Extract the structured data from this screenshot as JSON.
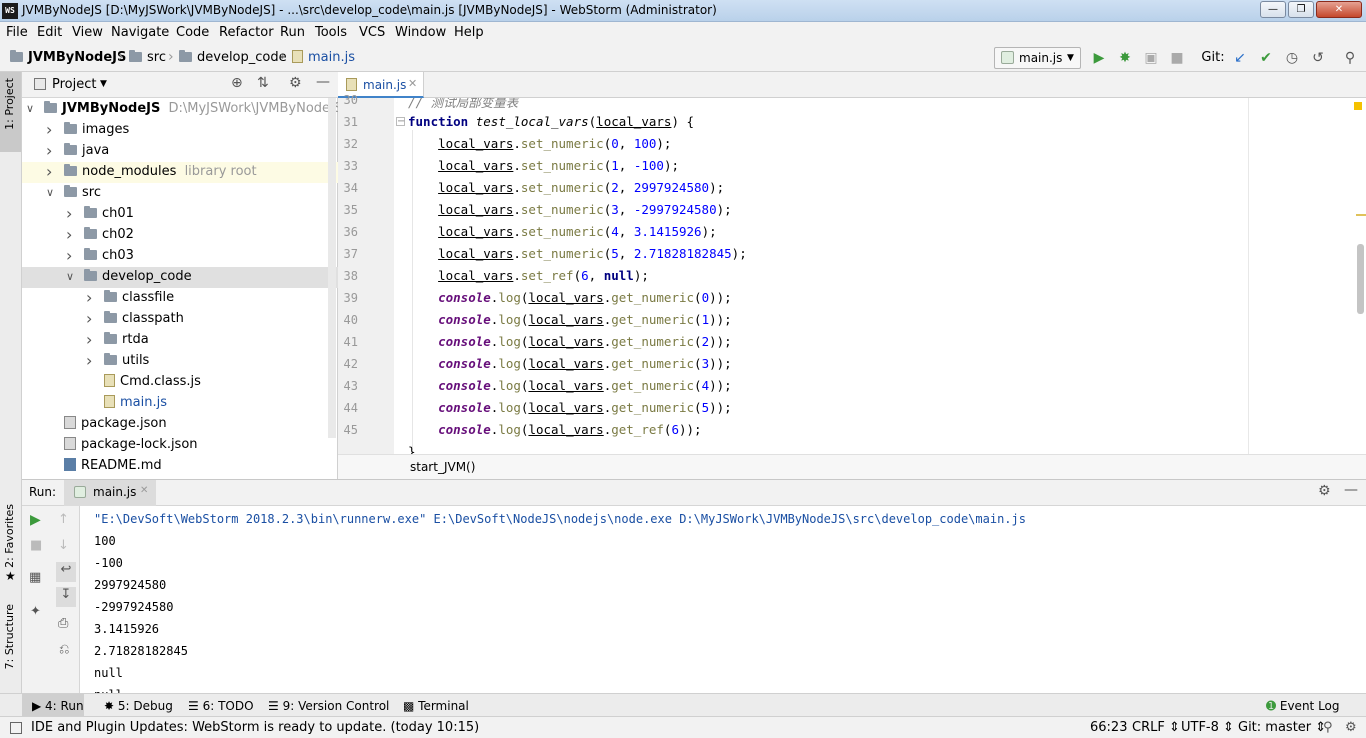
{
  "window": {
    "title": "JVMByNodeJS [D:\\MyJSWork\\JVMByNodeJS] - ...\\src\\develop_code\\main.js [JVMByNodeJS] - WebStorm (Administrator)",
    "icon_text": "WS"
  },
  "menu": [
    "File",
    "Edit",
    "View",
    "Navigate",
    "Code",
    "Refactor",
    "Run",
    "Tools",
    "VCS",
    "Window",
    "Help"
  ],
  "nav": {
    "crumbs": [
      "JVMByNodeJS",
      "src",
      "develop_code",
      "main.js"
    ],
    "run_config": "main.js",
    "git_label": "Git:"
  },
  "left_strip": {
    "project": "1: Project",
    "favorites": "2: Favorites",
    "structure": "7: Structure"
  },
  "project": {
    "header": "Project",
    "tree": [
      {
        "label": "JVMByNodeJS",
        "extra": "D:\\MyJSWork\\JVMByNodeJS",
        "kind": "folder",
        "depth": 0,
        "expanded": true
      },
      {
        "label": "images",
        "kind": "folder",
        "depth": 1,
        "expanded": false
      },
      {
        "label": "java",
        "kind": "folder",
        "depth": 1,
        "expanded": false
      },
      {
        "label": "node_modules",
        "extra": "library root",
        "kind": "folder",
        "depth": 1,
        "expanded": false
      },
      {
        "label": "src",
        "kind": "folder",
        "depth": 1,
        "expanded": true
      },
      {
        "label": "ch01",
        "kind": "folder",
        "depth": 2,
        "expanded": false
      },
      {
        "label": "ch02",
        "kind": "folder",
        "depth": 2,
        "expanded": false
      },
      {
        "label": "ch03",
        "kind": "folder",
        "depth": 2,
        "expanded": false
      },
      {
        "label": "develop_code",
        "kind": "folder",
        "depth": 2,
        "expanded": true
      },
      {
        "label": "classfile",
        "kind": "folder",
        "depth": 3,
        "expanded": false
      },
      {
        "label": "classpath",
        "kind": "folder",
        "depth": 3,
        "expanded": false
      },
      {
        "label": "rtda",
        "kind": "folder",
        "depth": 3,
        "expanded": false
      },
      {
        "label": "utils",
        "kind": "folder",
        "depth": 3,
        "expanded": false
      },
      {
        "label": "Cmd.class.js",
        "kind": "js",
        "depth": 3
      },
      {
        "label": "main.js",
        "kind": "js",
        "depth": 3
      },
      {
        "label": "package.json",
        "kind": "json",
        "depth": 1
      },
      {
        "label": "package-lock.json",
        "kind": "json",
        "depth": 1
      },
      {
        "label": "README.md",
        "kind": "md",
        "depth": 1
      }
    ]
  },
  "editor": {
    "tab": "main.js",
    "breadcrumb": "start_JVM()",
    "lines": [
      {
        "n": "30",
        "kind": "comment",
        "text": "// 测试局部变量表"
      },
      {
        "n": "31",
        "kind": "funcdef",
        "text": "test_local_vars"
      },
      {
        "n": "32",
        "kind": "set",
        "method": "set_numeric",
        "args": [
          "0",
          "100"
        ]
      },
      {
        "n": "33",
        "kind": "set",
        "method": "set_numeric",
        "args": [
          "1",
          "-100"
        ]
      },
      {
        "n": "34",
        "kind": "set",
        "method": "set_numeric",
        "args": [
          "2",
          "2997924580"
        ]
      },
      {
        "n": "35",
        "kind": "set",
        "method": "set_numeric",
        "args": [
          "3",
          "-2997924580"
        ]
      },
      {
        "n": "36",
        "kind": "set",
        "method": "set_numeric",
        "args": [
          "4",
          "3.1415926"
        ]
      },
      {
        "n": "37",
        "kind": "set",
        "method": "set_numeric",
        "args": [
          "5",
          "2.71828182845"
        ]
      },
      {
        "n": "38",
        "kind": "set",
        "method": "set_ref",
        "args": [
          "6",
          "null"
        ]
      },
      {
        "n": "39",
        "kind": "log",
        "method": "get_numeric",
        "arg": "0"
      },
      {
        "n": "40",
        "kind": "log",
        "method": "get_numeric",
        "arg": "1"
      },
      {
        "n": "41",
        "kind": "log",
        "method": "get_numeric",
        "arg": "2"
      },
      {
        "n": "42",
        "kind": "log",
        "method": "get_numeric",
        "arg": "3"
      },
      {
        "n": "43",
        "kind": "log",
        "method": "get_numeric",
        "arg": "4"
      },
      {
        "n": "44",
        "kind": "log",
        "method": "get_numeric",
        "arg": "5"
      },
      {
        "n": "45",
        "kind": "log",
        "method": "get_ref",
        "arg": "6"
      }
    ],
    "tokens": {
      "function": "function",
      "param": "local_vars",
      "console": "console",
      "log": "log"
    }
  },
  "run": {
    "label": "Run:",
    "tab": "main.js",
    "output": [
      "\"E:\\DevSoft\\WebStorm 2018.2.3\\bin\\runnerw.exe\" E:\\DevSoft\\NodeJS\\nodejs\\node.exe D:\\MyJSWork\\JVMByNodeJS\\src\\develop_code\\main.js",
      "100",
      "-100",
      "2997924580",
      "-2997924580",
      "3.1415926",
      "2.71828182845",
      "null",
      "null"
    ]
  },
  "bottom_tabs": [
    "4: Run",
    "5: Debug",
    "6: TODO",
    "9: Version Control",
    "Terminal"
  ],
  "event_log": "Event Log",
  "status": {
    "message": "IDE and Plugin Updates: WebStorm is ready to update. (today 10:15)",
    "position": "66:23",
    "line_sep": "CRLF",
    "encoding": "UTF-8",
    "git_branch": "Git: master"
  },
  "colors": {
    "keyword": "#000080",
    "number": "#0000ff",
    "method": "#7a7a43",
    "console": "#660e7a",
    "comment": "#808080",
    "run_green": "#3c9a3c"
  }
}
